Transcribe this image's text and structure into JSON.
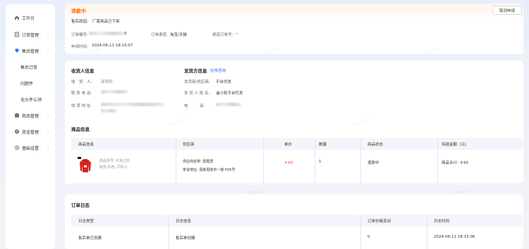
{
  "sidebar": {
    "items": [
      {
        "label": "工作台",
        "icon": "home-icon"
      },
      {
        "label": "订单管理",
        "icon": "document-icon",
        "chevron": "⌄"
      },
      {
        "label": "售后管理",
        "icon": "diamond-icon",
        "chevron": "⌃"
      },
      {
        "label": "售后订单"
      },
      {
        "label": "问题件"
      },
      {
        "label": "无头件认领"
      },
      {
        "label": "商品管理",
        "icon": "box-icon",
        "chevron": "⌄"
      },
      {
        "label": "资金管理",
        "icon": "wallet-icon",
        "chevron": "⌄"
      },
      {
        "label": "基础设置",
        "icon": "settings-icon",
        "chevron": "⌄"
      }
    ]
  },
  "header": {
    "status": "退款中",
    "reason_label": "售后原因:",
    "reason_value": "厂家商品已下架",
    "cancel_label": "取消申请",
    "order_no_label": "订单编号:",
    "order_no_tail": "0",
    "channel_label": "订单渠道:",
    "channel_value": "淘宝/天猫",
    "channel_order_label": "渠道订单号:",
    "channel_order_value": "--",
    "apply_time_label": "申请时间:",
    "apply_time_value": "2024-06-11 18:15:07"
  },
  "receiver": {
    "title": "收货人信息",
    "name_label": "收　货　人:",
    "name_value": "周照明",
    "phone_label": "联 系 电 话:",
    "address_label": "收 货 地 址:"
  },
  "shipper": {
    "title": "发货方信息",
    "edit_link": "在线咨询",
    "vendor_label": "发货商/供应商:",
    "vendor_value": "平台代发",
    "contact_label": "发 货 人 姓 名:",
    "contact_value": "遥小松平台代发",
    "phone_label": "电　　　话:"
  },
  "goods": {
    "title": "商品信息",
    "columns": [
      "商品信息",
      "供应商",
      "单价",
      "数量",
      "商品状态",
      "待退金额（元)"
    ],
    "row": {
      "desc1": "商品货号: 红色卫衣",
      "desc2": "颜色:红色; 尺码:L",
      "supplier_line1": "供应商名称: 雷霆居",
      "supplier_line2": "拿货地址: 洞斯周购市一楼-F05号",
      "price": "￥65",
      "qty": "1",
      "status": "退款中",
      "total": "商品合计: ￥65"
    }
  },
  "log": {
    "title": "订单日志",
    "columns": [
      "日志类型",
      "日志信息",
      "订单价格变动",
      "日志时间"
    ],
    "rows": [
      {
        "type": "售后单已创建",
        "info": "售后单创建",
        "change": "0",
        "time": "2024-06-11 18:15:06"
      }
    ]
  },
  "watermark": "王昌 9995",
  "colors": {
    "accent": "#2f6bff",
    "status": "#ff6a00",
    "price": "#ff3b30"
  }
}
